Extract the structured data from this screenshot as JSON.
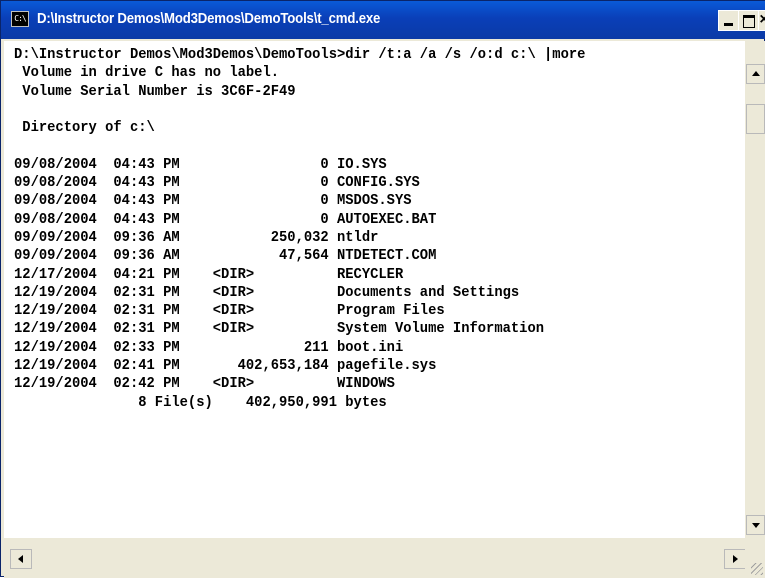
{
  "window": {
    "title": "D:\\Instructor Demos\\Mod3Demos\\DemoTools\\t_cmd.exe",
    "icon_label": "C:\\"
  },
  "console": {
    "lines": [
      "D:\\Instructor Demos\\Mod3Demos\\DemoTools>dir /t:a /a /s /o:d c:\\ |more",
      " Volume in drive C has no label.",
      " Volume Serial Number is 3C6F-2F49",
      "",
      " Directory of c:\\",
      "",
      "09/08/2004  04:43 PM                 0 IO.SYS",
      "09/08/2004  04:43 PM                 0 CONFIG.SYS",
      "09/08/2004  04:43 PM                 0 MSDOS.SYS",
      "09/08/2004  04:43 PM                 0 AUTOEXEC.BAT",
      "09/09/2004  09:36 AM           250,032 ntldr",
      "09/09/2004  09:36 AM            47,564 NTDETECT.COM",
      "12/17/2004  04:21 PM    <DIR>          RECYCLER",
      "12/19/2004  02:31 PM    <DIR>          Documents and Settings",
      "12/19/2004  02:31 PM    <DIR>          Program Files",
      "12/19/2004  02:31 PM    <DIR>          System Volume Information",
      "12/19/2004  02:33 PM               211 boot.ini",
      "12/19/2004  02:41 PM       402,653,184 pagefile.sys",
      "12/19/2004  02:42 PM    <DIR>          WINDOWS",
      "               8 File(s)    402,950,991 bytes"
    ]
  },
  "icons": {
    "app_icon": "console-icon",
    "minimize": "minimize-icon",
    "maximize": "maximize-icon",
    "close": "close-icon",
    "scroll_up": "arrow-up-icon",
    "scroll_down": "arrow-down-icon",
    "scroll_left": "arrow-left-icon",
    "scroll_right": "arrow-right-icon"
  },
  "colors": {
    "titlebar": "#0b3aa6",
    "console_bg": "#ffffff",
    "console_text": "#000000",
    "chrome": "#ece9d8"
  }
}
